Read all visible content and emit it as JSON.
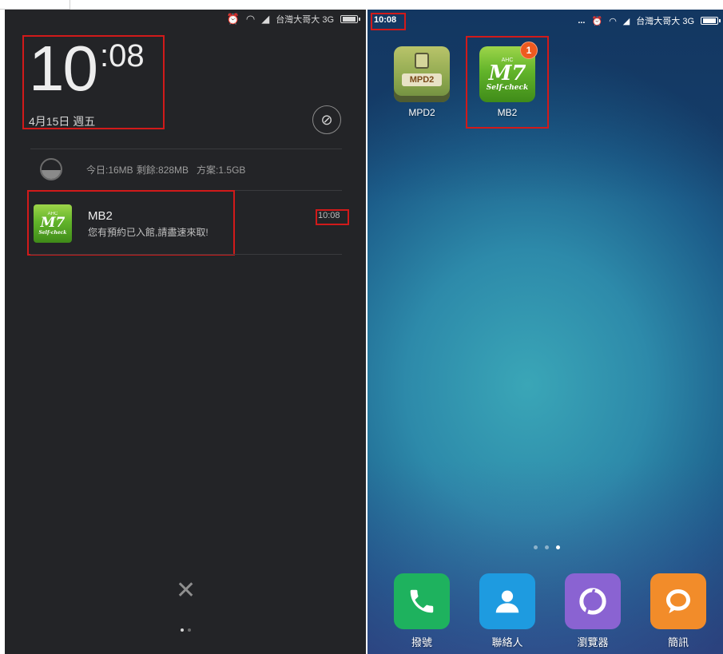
{
  "left_panel": {
    "status_bar": {
      "carrier": "台灣大哥大 3G"
    },
    "clock": {
      "hour": "10",
      "minutes": ":08",
      "date": "4月15日 週五"
    },
    "data_usage": {
      "today": "今日:16MB",
      "remaining": "剩餘:828MB",
      "plan": "方案:1.5GB"
    },
    "notification": {
      "app_name": "MB2",
      "message": "您有預約已入館,請盡速來取!",
      "time": "10:08",
      "icon_text": {
        "top": "AHC",
        "middle": "M7",
        "bottom": "Self-check"
      }
    }
  },
  "right_panel": {
    "status_bar": {
      "time": "10:08",
      "overflow": "...",
      "carrier": "台灣大哥大 3G"
    },
    "apps": [
      {
        "label": "MPD2",
        "icon_text": "MPD2"
      },
      {
        "label": "MB2",
        "badge": "1",
        "icon_text": {
          "top": "AHC",
          "middle": "M7",
          "bottom": "Self-check"
        }
      }
    ],
    "dock": [
      {
        "label": "撥號",
        "color": "#1eb25e"
      },
      {
        "label": "聯絡人",
        "color": "#1e9be0"
      },
      {
        "label": "瀏覽器",
        "color": "#8a63d2"
      },
      {
        "label": "簡訊",
        "color": "#f28c2a"
      }
    ]
  },
  "colors": {
    "highlight_box": "#d11a1a",
    "shade_background": "#232427"
  }
}
